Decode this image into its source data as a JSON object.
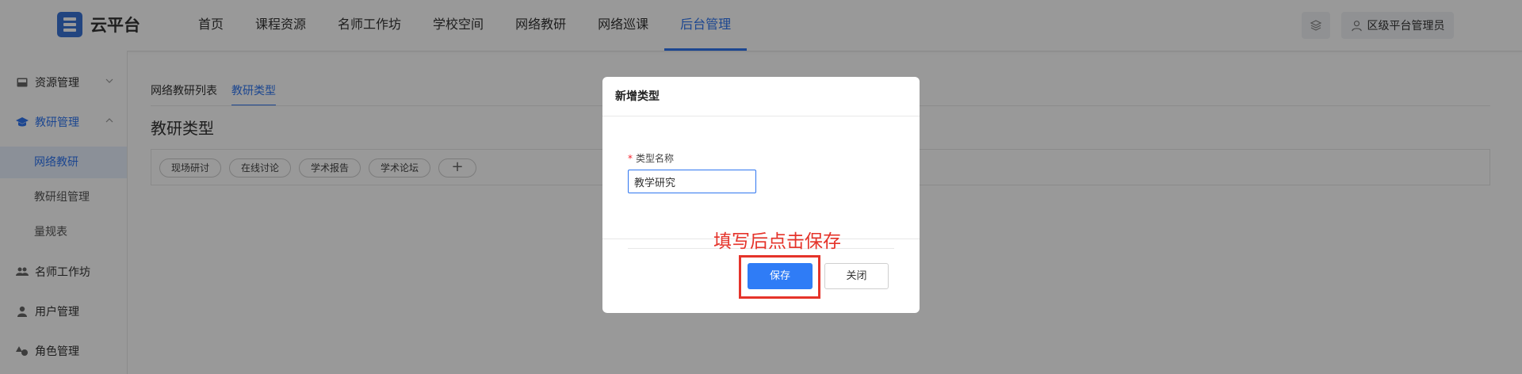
{
  "app": {
    "logo_text": "云平台"
  },
  "nav": {
    "items": [
      "首页",
      "课程资源",
      "名师工作坊",
      "学校空间",
      "网络教研",
      "网络巡课",
      "后台管理"
    ],
    "active_index": 6
  },
  "header": {
    "user_label": "区级平台管理员",
    "layers_icon": "layers-icon",
    "user_icon": "user-icon"
  },
  "sidebar": {
    "resource": {
      "label": "资源管理",
      "icon": "inbox-icon"
    },
    "research": {
      "label": "教研管理",
      "icon": "graduation-cap-icon"
    },
    "sub_items": [
      "网络教研",
      "教研组管理",
      "量规表"
    ],
    "workshop": {
      "label": "名师工作坊",
      "icon": "users-icon"
    },
    "user": {
      "label": "用户管理",
      "icon": "person-icon"
    },
    "role": {
      "label": "角色管理",
      "icon": "shapes-icon"
    }
  },
  "main": {
    "tabs": [
      "网络教研列表",
      "教研类型"
    ],
    "active_tab": 1,
    "title": "教研类型",
    "chips": [
      "现场研讨",
      "在线讨论",
      "学术报告",
      "学术论坛"
    ],
    "add_chip": "+"
  },
  "dialog": {
    "title": "新增类型",
    "field_required_mark": "*",
    "field_label": "类型名称",
    "field_value": "教学研究",
    "save_label": "保存",
    "close_label": "关闭"
  },
  "annotation": {
    "text": "填写后点击保存"
  },
  "colors": {
    "accent": "#2f76f0",
    "annotation": "#e5332a",
    "required": "#f5222d"
  }
}
